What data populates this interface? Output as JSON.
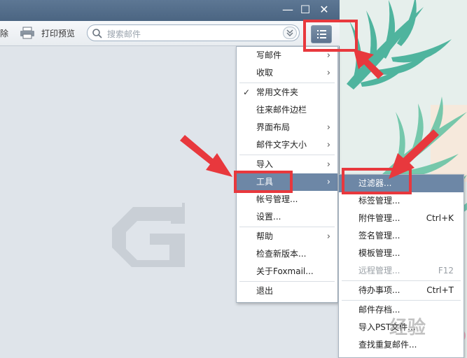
{
  "window": {
    "controls": {
      "minimize": "—",
      "maximize": "☐",
      "close": "✕"
    }
  },
  "toolbar": {
    "delete_partial": "除",
    "print_preview": "打印预览",
    "search_placeholder": "搜索邮件"
  },
  "main_menu": {
    "items": [
      {
        "label": "写邮件",
        "has_submenu": true
      },
      {
        "label": "收取",
        "has_submenu": true
      },
      {
        "label": "常用文件夹",
        "checked": true
      },
      {
        "label": "往来邮件边栏"
      },
      {
        "label": "界面布局",
        "has_submenu": true
      },
      {
        "label": "邮件文字大小",
        "has_submenu": true
      },
      {
        "label": "导入",
        "has_submenu": true
      },
      {
        "label": "工具",
        "has_submenu": true,
        "selected": true
      },
      {
        "label": "帐号管理..."
      },
      {
        "label": "设置..."
      },
      {
        "label": "帮助",
        "has_submenu": true
      },
      {
        "label": "检查新版本..."
      },
      {
        "label": "关于Foxmail..."
      },
      {
        "label": "退出"
      }
    ]
  },
  "tools_submenu": {
    "items": [
      {
        "label": "过滤器...",
        "selected": true
      },
      {
        "label": "标签管理..."
      },
      {
        "label": "附件管理...",
        "shortcut": "Ctrl+K"
      },
      {
        "label": "签名管理..."
      },
      {
        "label": "模板管理..."
      },
      {
        "label": "远程管理...",
        "shortcut": "F12",
        "disabled": true
      },
      {
        "label": "待办事项...",
        "shortcut": "Ctrl+T"
      },
      {
        "label": "邮件存档..."
      },
      {
        "label": "导入PST文件..."
      },
      {
        "label": "查找重复邮件..."
      }
    ]
  },
  "watermark": {
    "text": "经验"
  },
  "colors": {
    "annotation": "#e8383d",
    "titlebar": "#4b6582",
    "menu_highlight": "#6d87a6"
  }
}
